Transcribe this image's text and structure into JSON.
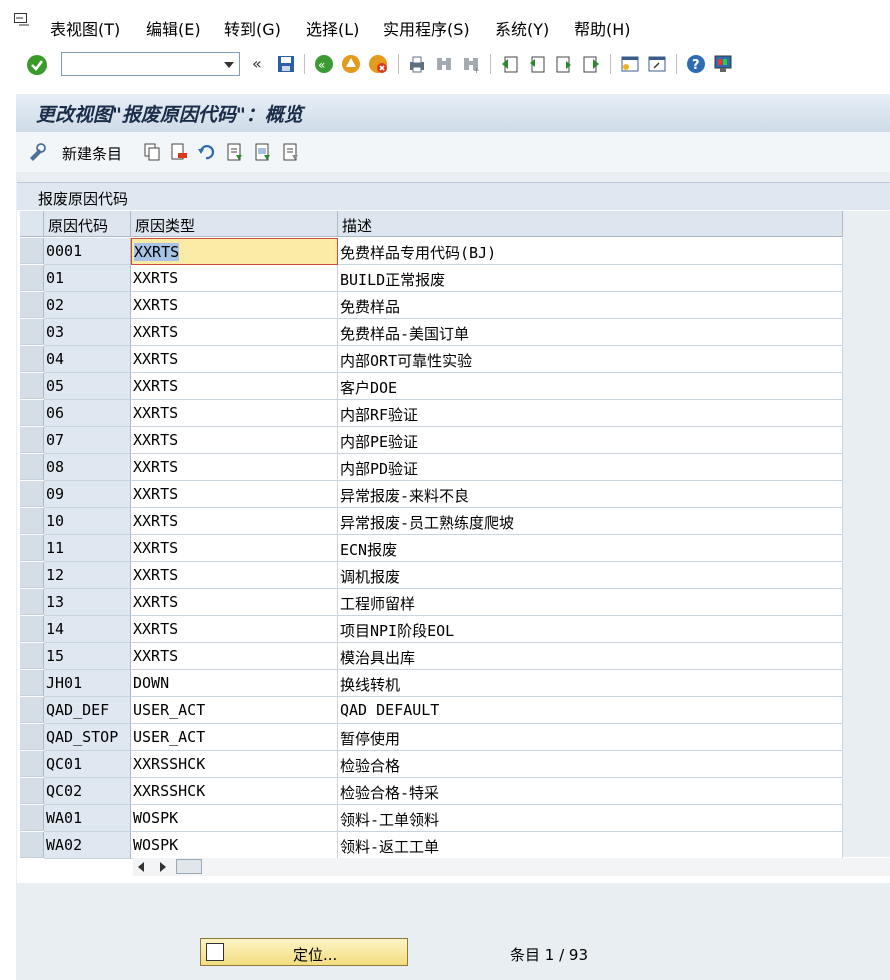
{
  "menu": [
    "表视图(T)",
    "编辑(E)",
    "转到(G)",
    "选择(L)",
    "实用程序(S)",
    "系统(Y)",
    "帮助(H)"
  ],
  "title": "更改视图\"报废原因代码\"：概览",
  "app_toolbar": {
    "new_entry": "新建条目"
  },
  "table": {
    "caption": "报废原因代码",
    "columns": [
      "原因代码",
      "原因类型",
      "描述"
    ],
    "rows": [
      {
        "code": "0001",
        "type": "XXRTS",
        "desc": "免费样品专用代码(BJ)"
      },
      {
        "code": "01",
        "type": "XXRTS",
        "desc": "BUILD正常报废"
      },
      {
        "code": "02",
        "type": "XXRTS",
        "desc": "免费样品"
      },
      {
        "code": "03",
        "type": "XXRTS",
        "desc": "免费样品-美国订单"
      },
      {
        "code": "04",
        "type": "XXRTS",
        "desc": "内部ORT可靠性实验"
      },
      {
        "code": "05",
        "type": "XXRTS",
        "desc": "客户DOE"
      },
      {
        "code": "06",
        "type": "XXRTS",
        "desc": "内部RF验证"
      },
      {
        "code": "07",
        "type": "XXRTS",
        "desc": "内部PE验证"
      },
      {
        "code": "08",
        "type": "XXRTS",
        "desc": "内部PD验证"
      },
      {
        "code": "09",
        "type": "XXRTS",
        "desc": "异常报废-来料不良"
      },
      {
        "code": "10",
        "type": "XXRTS",
        "desc": "异常报废-员工熟练度爬坡"
      },
      {
        "code": "11",
        "type": "XXRTS",
        "desc": "ECN报废"
      },
      {
        "code": "12",
        "type": "XXRTS",
        "desc": "调机报废"
      },
      {
        "code": "13",
        "type": "XXRTS",
        "desc": "工程师留样"
      },
      {
        "code": "14",
        "type": "XXRTS",
        "desc": "项目NPI阶段EOL"
      },
      {
        "code": "15",
        "type": "XXRTS",
        "desc": "模治具出库"
      },
      {
        "code": "JH01",
        "type": "DOWN",
        "desc": "换线转机"
      },
      {
        "code": "QAD_DEF",
        "type": "USER_ACT",
        "desc": "QAD DEFAULT"
      },
      {
        "code": "QAD_STOP",
        "type": "USER_ACT",
        "desc": "暂停使用"
      },
      {
        "code": "QC01",
        "type": "XXRSSHCK",
        "desc": "检验合格"
      },
      {
        "code": "QC02",
        "type": "XXRSSHCK",
        "desc": "检验合格-特采"
      },
      {
        "code": "WA01",
        "type": "WOSPK",
        "desc": "领料-工单领料"
      },
      {
        "code": "WA02",
        "type": "WOSPK",
        "desc": "领料-返工工单"
      }
    ]
  },
  "position_button": "定位...",
  "entry_counter": "条目 1 / 93"
}
